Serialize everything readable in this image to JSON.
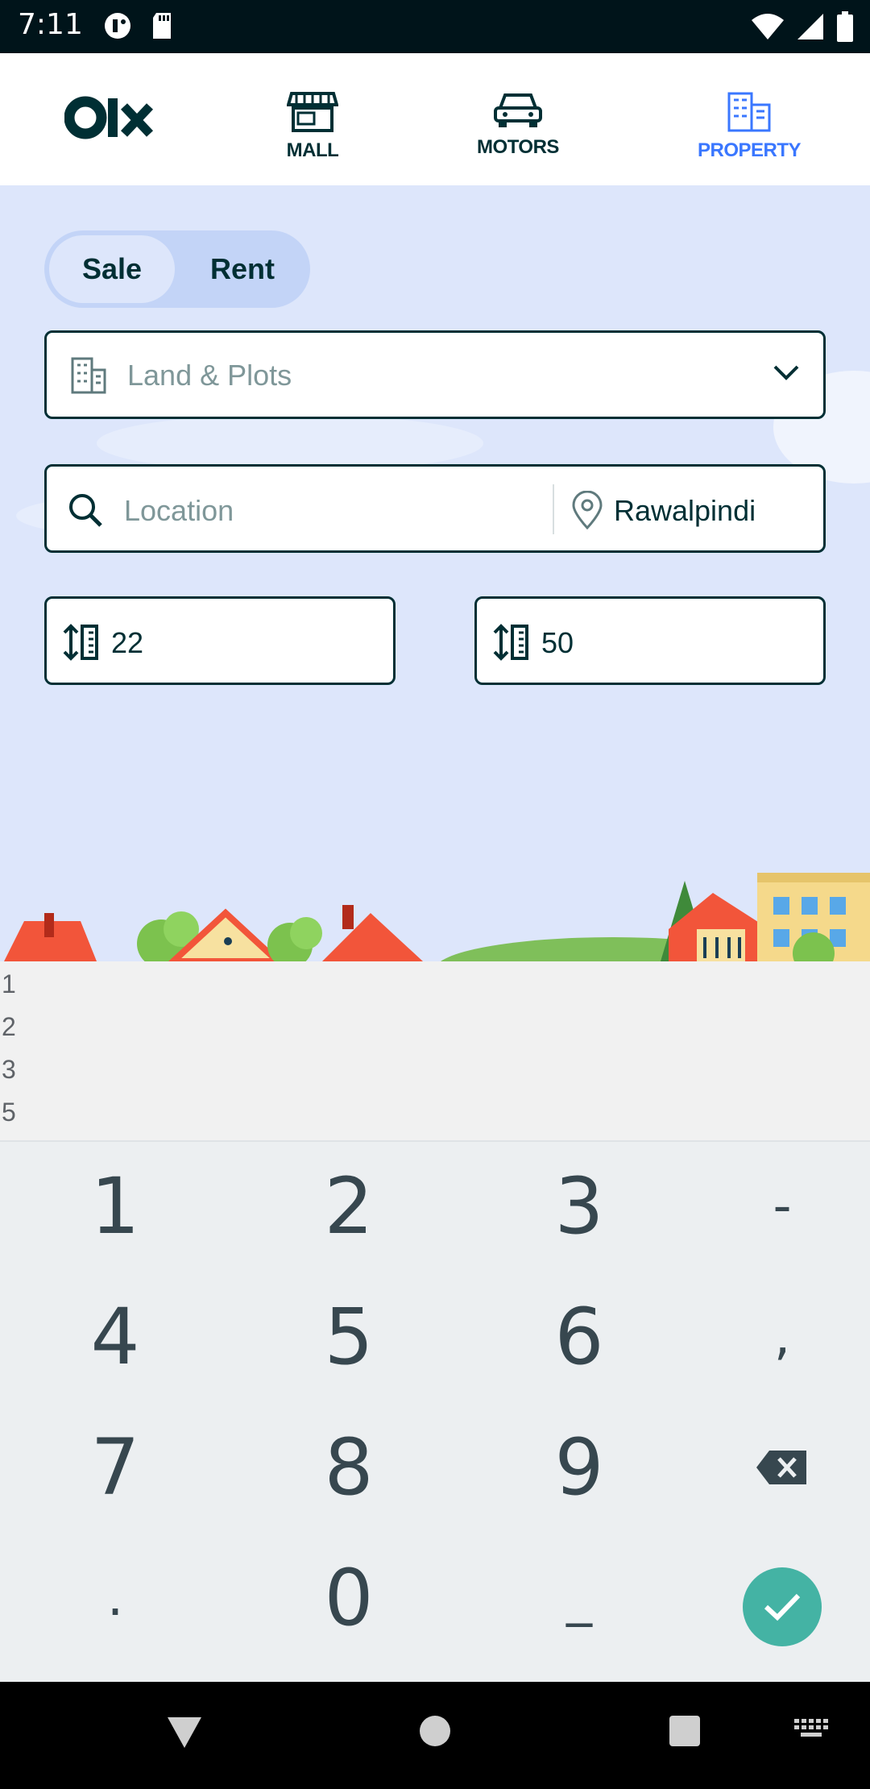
{
  "status": {
    "time": "7:11"
  },
  "nav": {
    "logo": "olx",
    "items": [
      {
        "label": "MALL"
      },
      {
        "label": "MOTORS"
      },
      {
        "label": "PROPERTY",
        "active": true
      }
    ]
  },
  "search": {
    "purpose_tabs": [
      "Sale",
      "Rent"
    ],
    "selected_purpose": "Sale",
    "category": "Land & Plots",
    "location_placeholder": "Location",
    "city": "Rawalpindi",
    "area_min": "22",
    "area_max": "50"
  },
  "suggestions": [
    "1",
    "2",
    "3",
    "5"
  ],
  "keyboard": {
    "keys": [
      [
        "1",
        "2",
        "3",
        "-"
      ],
      [
        "4",
        "5",
        "6",
        ","
      ],
      [
        "7",
        "8",
        "9",
        "backspace"
      ],
      [
        ".",
        "0",
        "_",
        "done"
      ]
    ]
  },
  "colors": {
    "accent": "#3a77ff",
    "dark": "#002f34",
    "hero_bg": "#dde6fb",
    "done": "#44b3a4"
  }
}
